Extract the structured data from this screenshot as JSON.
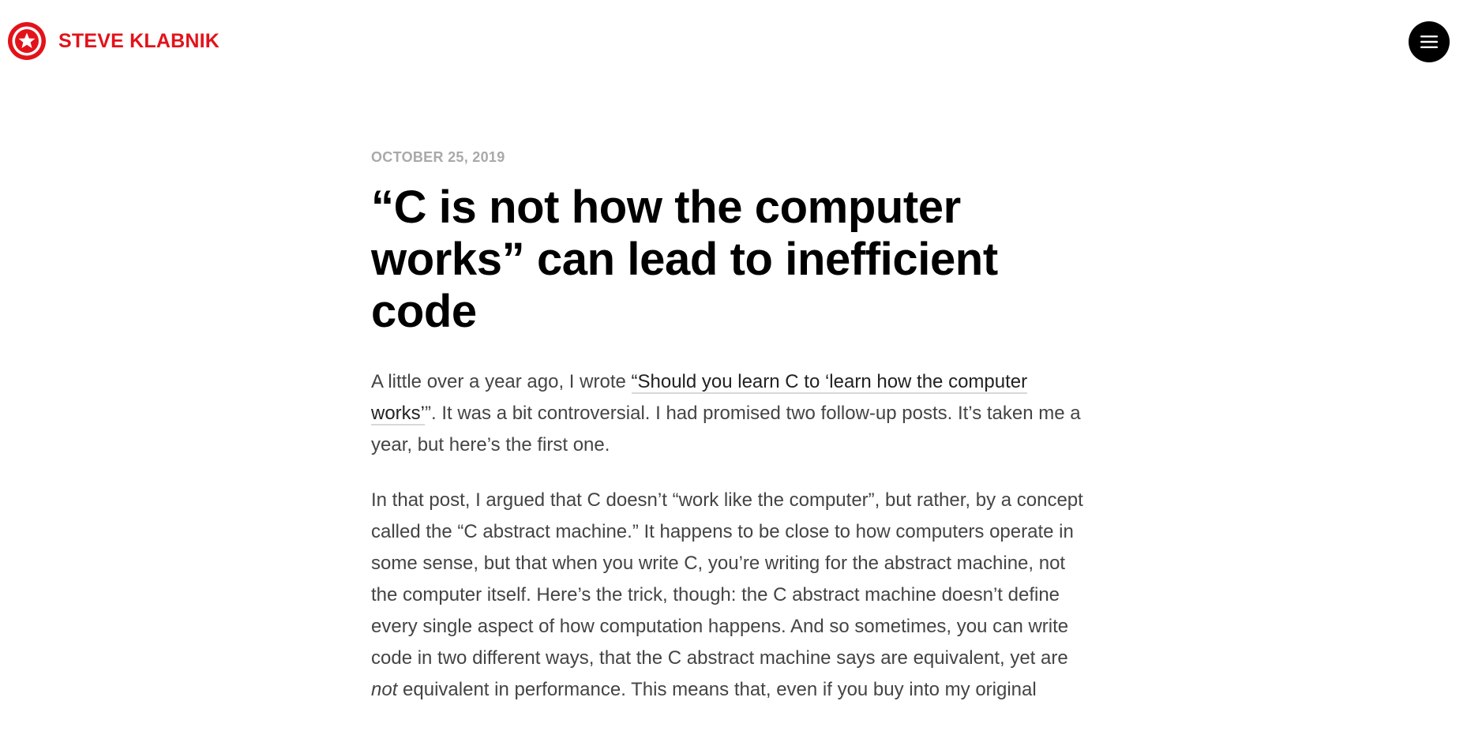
{
  "header": {
    "site_name": "STEVE KLABNIK",
    "logo_icon": "red-circle-star-icon",
    "menu_icon": "hamburger-menu-icon",
    "brand_color": "#e3121a"
  },
  "post": {
    "date": "OCTOBER 25, 2019",
    "title": "“C is not how the computer works” can lead to inefficient code",
    "paragraph_1": {
      "before_link": "A little over a year ago, I wrote ",
      "link_text": "“Should you learn C to ‘learn how the computer works’",
      "after_link": "”. It was a bit controversial. I had promised two follow-up posts. It’s taken me a year, but here’s the first one."
    },
    "paragraph_2": {
      "before_emphasis": "In that post, I argued that C doesn’t “work like the computer”, but rather, by a concept called the “C abstract machine.” It happens to be close to how computers operate in some sense, but that when you write C, you’re writing for the abstract machine, not the computer itself. Here’s the trick, though: the C abstract machine doesn’t define every single aspect of how computation happens. And so sometimes, you can write code in two different ways, that the C abstract machine says are equivalent, yet are ",
      "emphasis": "not",
      "after_emphasis": " equivalent in performance. This means that, even if you buy into my original"
    }
  }
}
